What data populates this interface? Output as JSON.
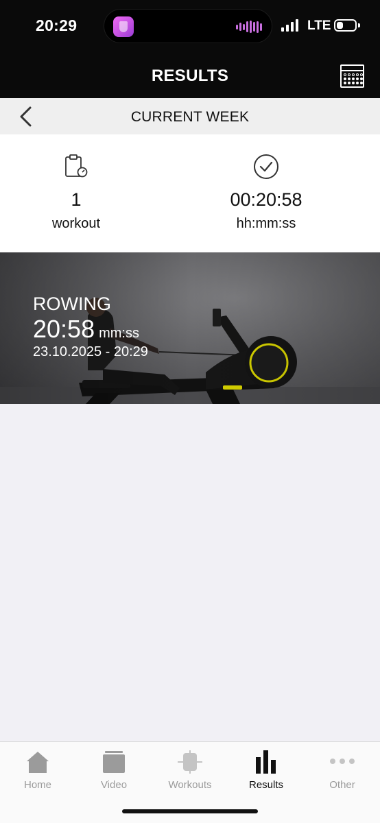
{
  "status_bar": {
    "time": "20:29",
    "network": "LTE",
    "battery_level": 0.25
  },
  "header": {
    "title": "RESULTS",
    "calendar_icon": "calendar-icon"
  },
  "week_nav": {
    "title": "CURRENT WEEK",
    "back_icon": "chevron-left-icon"
  },
  "summary": {
    "workouts": {
      "icon": "clipboard-timer-icon",
      "value": "1",
      "unit": "workout"
    },
    "duration": {
      "icon": "check-circle-icon",
      "value": "00:20:58",
      "unit": "hh:mm:ss"
    }
  },
  "workout_card": {
    "type": "ROWING",
    "duration": "20:58",
    "duration_unit": "mm:ss",
    "date": "23.10.2025 - 20:29",
    "accent_color": "#d6d200"
  },
  "tab_bar": {
    "active": "Results",
    "tabs": [
      {
        "label": "Home",
        "icon": "home-icon"
      },
      {
        "label": "Video",
        "icon": "video-folder-icon"
      },
      {
        "label": "Workouts",
        "icon": "dumbbell-icon"
      },
      {
        "label": "Results",
        "icon": "bar-chart-icon"
      },
      {
        "label": "Other",
        "icon": "more-dots-icon"
      }
    ]
  },
  "colors": {
    "header_bg": "#0a0a0a",
    "nav_bg": "#efefef",
    "page_bg": "#f1f0f5",
    "tab_inactive": "#9b9b9b",
    "tab_active": "#111111"
  }
}
